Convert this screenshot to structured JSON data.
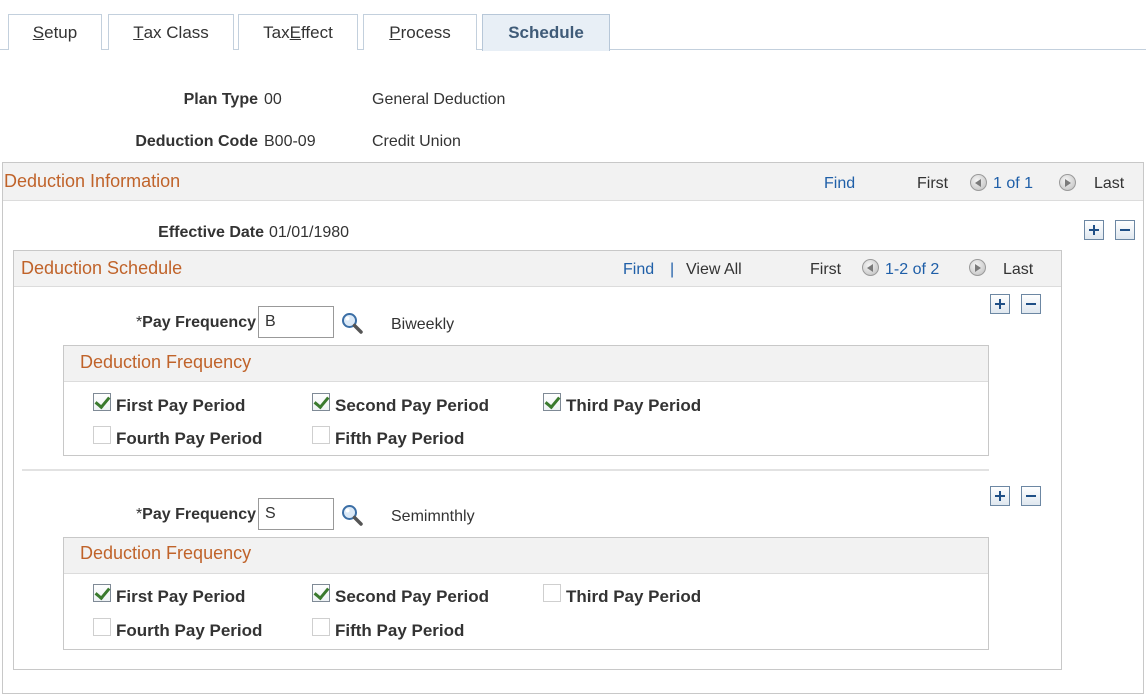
{
  "tabs": [
    {
      "pre": "",
      "u": "S",
      "post": "etup"
    },
    {
      "pre": "",
      "u": "T",
      "post": "ax Class"
    },
    {
      "pre": "Tax ",
      "u": "E",
      "post": "ffect"
    },
    {
      "pre": "",
      "u": "P",
      "post": "rocess"
    },
    {
      "pre": "Schedule",
      "u": "",
      "post": ""
    }
  ],
  "header": {
    "plan_type_label": "Plan Type",
    "plan_type_value": "00",
    "plan_type_desc": "General Deduction",
    "deduction_code_label": "Deduction Code",
    "deduction_code_value": "B00-09",
    "deduction_code_desc": "Credit Union"
  },
  "deduction_information": {
    "title": "Deduction Information",
    "find": "Find",
    "first": "First",
    "count": "1 of 1",
    "last": "Last",
    "effective_date_label": "Effective Date",
    "effective_date_value": "01/01/1980"
  },
  "deduction_schedule": {
    "title": "Deduction Schedule",
    "find": "Find",
    "separator": "|",
    "view_all": "View All",
    "first": "First",
    "count": "1-2 of 2",
    "last": "Last",
    "rows": [
      {
        "pay_frequency_label": "Pay Frequency",
        "pay_frequency_value": "B",
        "pay_frequency_desc": "Biweekly",
        "freq_title": "Deduction Frequency",
        "periods": [
          {
            "label": "First Pay Period",
            "checked": true
          },
          {
            "label": "Second Pay Period",
            "checked": true
          },
          {
            "label": "Third Pay Period",
            "checked": true
          },
          {
            "label": "Fourth Pay Period",
            "checked": false
          },
          {
            "label": "Fifth Pay Period",
            "checked": false
          }
        ]
      },
      {
        "pay_frequency_label": "Pay Frequency",
        "pay_frequency_value": "S",
        "pay_frequency_desc": "Semimnthly",
        "freq_title": "Deduction Frequency",
        "periods": [
          {
            "label": "First Pay Period",
            "checked": true
          },
          {
            "label": "Second Pay Period",
            "checked": true
          },
          {
            "label": "Third Pay Period",
            "checked": false
          },
          {
            "label": "Fourth Pay Period",
            "checked": false
          },
          {
            "label": "Fifth Pay Period",
            "checked": false
          }
        ]
      }
    ]
  },
  "required_marker": "*",
  "icons": {
    "lookup": "magnifier-icon",
    "prev": "prev-arrow-icon",
    "next": "next-arrow-icon",
    "add": "plus-icon",
    "delete": "minus-icon"
  },
  "colors": {
    "section_title": "#c0632a",
    "link": "#1f5fa8",
    "active_tab_bg": "#e8eff6"
  }
}
